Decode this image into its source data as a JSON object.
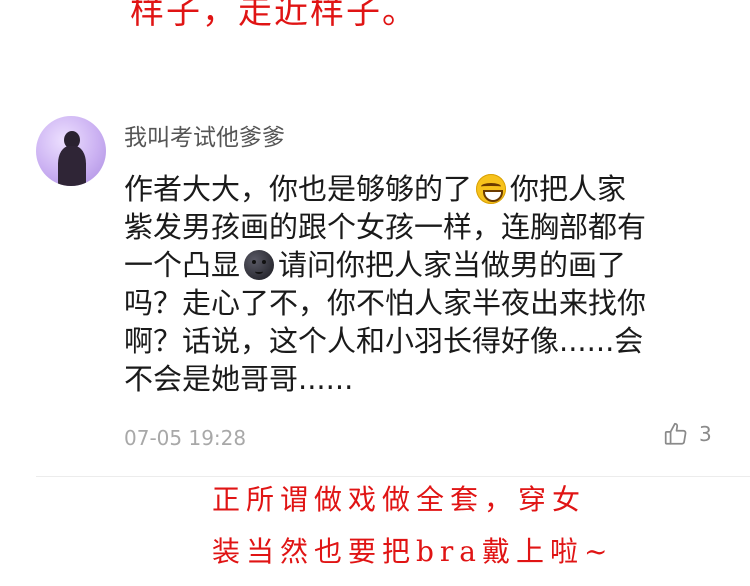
{
  "top_annotation": "样子，走近样子。",
  "comment": {
    "username": "我叫考试他爹爹",
    "lines": [
      {
        "before": "作者大大，你也是够够的了",
        "after": "你把人家"
      },
      {
        "text": "紫发男孩画的跟个女孩一样，连胸部都有"
      },
      {
        "before": "一个凸显",
        "after": "请问你把人家当做男的画了"
      },
      {
        "text": "吗？走心了不，你不怕人家半夜出来找你"
      },
      {
        "text": "啊？话说，这个人和小羽长得好像......会"
      },
      {
        "text": "不会是她哥哥......"
      }
    ],
    "emojis": {
      "grin": "grinning-squinting-face-emoji",
      "moon": "new-moon-face-emoji"
    },
    "timestamp": "07-05 19:28",
    "like_icon": "thumbs-up-icon",
    "like_count": "3"
  },
  "bottom_annotation": {
    "line1": "正所谓做戏做全套，穿女",
    "line2": "装当然也要把bra戴上啦~"
  },
  "colors": {
    "annotation_red": "#e01414",
    "username_gray": "#555555",
    "meta_gray": "#a8a8a8",
    "avatar_purple": "#cbb1f2"
  }
}
